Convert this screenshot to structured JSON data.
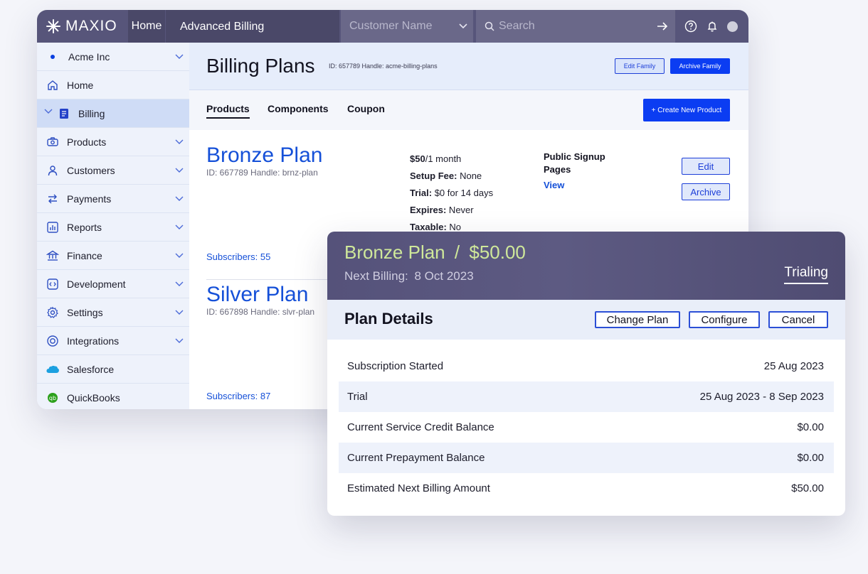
{
  "topbar": {
    "logo": "MAXIO",
    "home": "Home",
    "app_name": "Advanced Billing",
    "customer_placeholder": "Customer Name",
    "search_placeholder": "Search"
  },
  "sidebar": {
    "org": "Acme Inc",
    "items": [
      {
        "label": "Home"
      },
      {
        "label": "Billing"
      },
      {
        "label": "Products"
      },
      {
        "label": "Customers"
      },
      {
        "label": "Payments"
      },
      {
        "label": "Reports"
      },
      {
        "label": "Finance"
      },
      {
        "label": "Development"
      },
      {
        "label": "Settings"
      },
      {
        "label": "Integrations"
      },
      {
        "label": "Salesforce"
      },
      {
        "label": "QuickBooks"
      }
    ]
  },
  "page": {
    "title": "Billing Plans",
    "meta": "ID: 657789 Handle: acme-billing-plans",
    "edit_family": "Edit Family",
    "archive_family": "Archive Family"
  },
  "tabs": {
    "products": "Products",
    "components": "Components",
    "coupon": "Coupon",
    "create_button": "+ Create New Product"
  },
  "plans": [
    {
      "name": "Bronze Plan",
      "id_handle": "ID: 667789 Handle: brnz-plan",
      "subscribers": "Subscribers: 55",
      "price": "$50",
      "period": "/1 month",
      "setup_fee_label": "Setup Fee:",
      "setup_fee": " None",
      "trial_label": "Trial:",
      "trial": " $0 for 14 days",
      "expires_label": "Expires:",
      "expires": " Never",
      "taxable_label": "Taxable:",
      "taxable": " No",
      "signup_label": "Public Signup Pages",
      "signup_link": "View",
      "edit": "Edit",
      "archive": "Archive"
    },
    {
      "name": "Silver Plan",
      "id_handle": "ID: 667898 Handle: slvr-plan",
      "subscribers": "Subscribers: 87"
    }
  ],
  "subscription": {
    "plan": "Bronze Plan",
    "separator": "/",
    "price": "$50.00",
    "next_billing_label": "Next Billing:",
    "next_billing": "8 Oct 2023",
    "status": "Trialing",
    "section_title": "Plan Details",
    "change_plan": "Change Plan",
    "configure": "Configure",
    "cancel": "Cancel",
    "rows": [
      {
        "label": "Subscription Started",
        "value": "25 Aug 2023"
      },
      {
        "label": "Trial",
        "value": "25 Aug 2023 - 8 Sep 2023"
      },
      {
        "label": "Current Service Credit Balance",
        "value": "$0.00"
      },
      {
        "label": "Current Prepayment Balance",
        "value": "$0.00"
      },
      {
        "label": "Estimated Next Billing Amount",
        "value": "$50.00"
      }
    ]
  },
  "colors": {
    "topbar": "#57557a",
    "accent": "#0b3df2",
    "link": "#1550d8",
    "plan_title": "#cfe89a",
    "sidebar_bg": "#eef2fb",
    "sidebar_active": "#cfdcf6"
  }
}
